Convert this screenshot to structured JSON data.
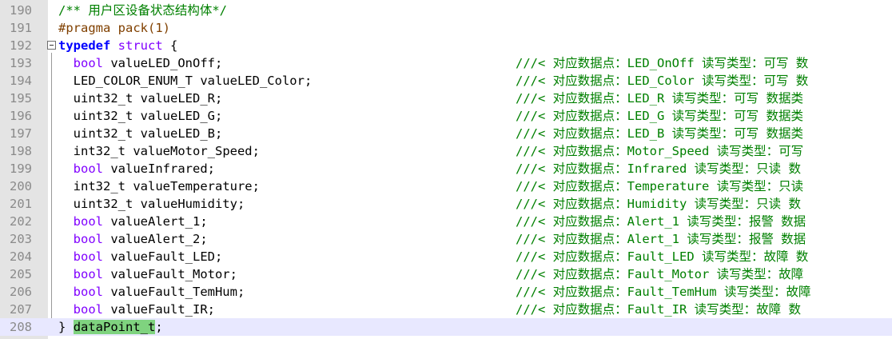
{
  "editor": {
    "lines": [
      {
        "n": "190",
        "kind": "comment",
        "text": "/** 用户区设备状态结构体*/"
      },
      {
        "n": "191",
        "kind": "pragma",
        "text": "#pragma pack(1)"
      },
      {
        "n": "192",
        "kind": "typedef",
        "kw": "typedef",
        "kw2": "struct",
        "rest": " {"
      },
      {
        "n": "193",
        "kind": "field",
        "type": "bool",
        "typeColored": true,
        "name": " valueLED_OnOff;",
        "comment": "///< 对应数据点：LED_OnOff 读写类型：可写 数"
      },
      {
        "n": "194",
        "kind": "field",
        "type": "LED_COLOR_ENUM_T",
        "typeColored": false,
        "name": " valueLED_Color;",
        "comment": "///< 对应数据点：LED_Color 读写类型：可写 数"
      },
      {
        "n": "195",
        "kind": "field",
        "type": "uint32_t",
        "typeColored": false,
        "name": " valueLED_R;",
        "comment": "///< 对应数据点：LED_R 读写类型：可写 数据类"
      },
      {
        "n": "196",
        "kind": "field",
        "type": "uint32_t",
        "typeColored": false,
        "name": " valueLED_G;",
        "comment": "///< 对应数据点：LED_G 读写类型：可写 数据类"
      },
      {
        "n": "197",
        "kind": "field",
        "type": "uint32_t",
        "typeColored": false,
        "name": " valueLED_B;",
        "comment": "///< 对应数据点：LED_B 读写类型：可写 数据类"
      },
      {
        "n": "198",
        "kind": "field",
        "type": "int32_t",
        "typeColored": false,
        "name": " valueMotor_Speed;",
        "comment": "///< 对应数据点：Motor_Speed 读写类型：可写"
      },
      {
        "n": "199",
        "kind": "field",
        "type": "bool",
        "typeColored": true,
        "name": " valueInfrared;",
        "comment": "///< 对应数据点：Infrared 读写类型：只读 数"
      },
      {
        "n": "200",
        "kind": "field",
        "type": "int32_t",
        "typeColored": false,
        "name": " valueTemperature;",
        "comment": "///< 对应数据点：Temperature 读写类型：只读"
      },
      {
        "n": "201",
        "kind": "field",
        "type": "uint32_t",
        "typeColored": false,
        "name": " valueHumidity;",
        "comment": "///< 对应数据点：Humidity 读写类型：只读 数"
      },
      {
        "n": "202",
        "kind": "field",
        "type": "bool",
        "typeColored": true,
        "name": " valueAlert_1;",
        "comment": "///< 对应数据点：Alert_1 读写类型：报警 数据"
      },
      {
        "n": "203",
        "kind": "field",
        "type": "bool",
        "typeColored": true,
        "name": " valueAlert_2;",
        "comment": "///< 对应数据点：Alert_1 读写类型：报警 数据"
      },
      {
        "n": "204",
        "kind": "field",
        "type": "bool",
        "typeColored": true,
        "name": " valueFault_LED;",
        "comment": "///< 对应数据点：Fault_LED 读写类型：故障 数"
      },
      {
        "n": "205",
        "kind": "field",
        "type": "bool",
        "typeColored": true,
        "name": " valueFault_Motor;",
        "comment": "///< 对应数据点：Fault_Motor 读写类型：故障"
      },
      {
        "n": "206",
        "kind": "field",
        "type": "bool",
        "typeColored": true,
        "name": " valueFault_TemHum;",
        "comment": "///< 对应数据点：Fault_TemHum 读写类型：故障"
      },
      {
        "n": "207",
        "kind": "field",
        "type": "bool",
        "typeColored": true,
        "name": " valueFault_IR;",
        "comment": "///< 对应数据点：Fault_IR 读写类型：故障 数"
      },
      {
        "n": "208",
        "kind": "close",
        "brace": "}",
        "name": "dataPoint_t",
        "semi": ";"
      }
    ]
  }
}
